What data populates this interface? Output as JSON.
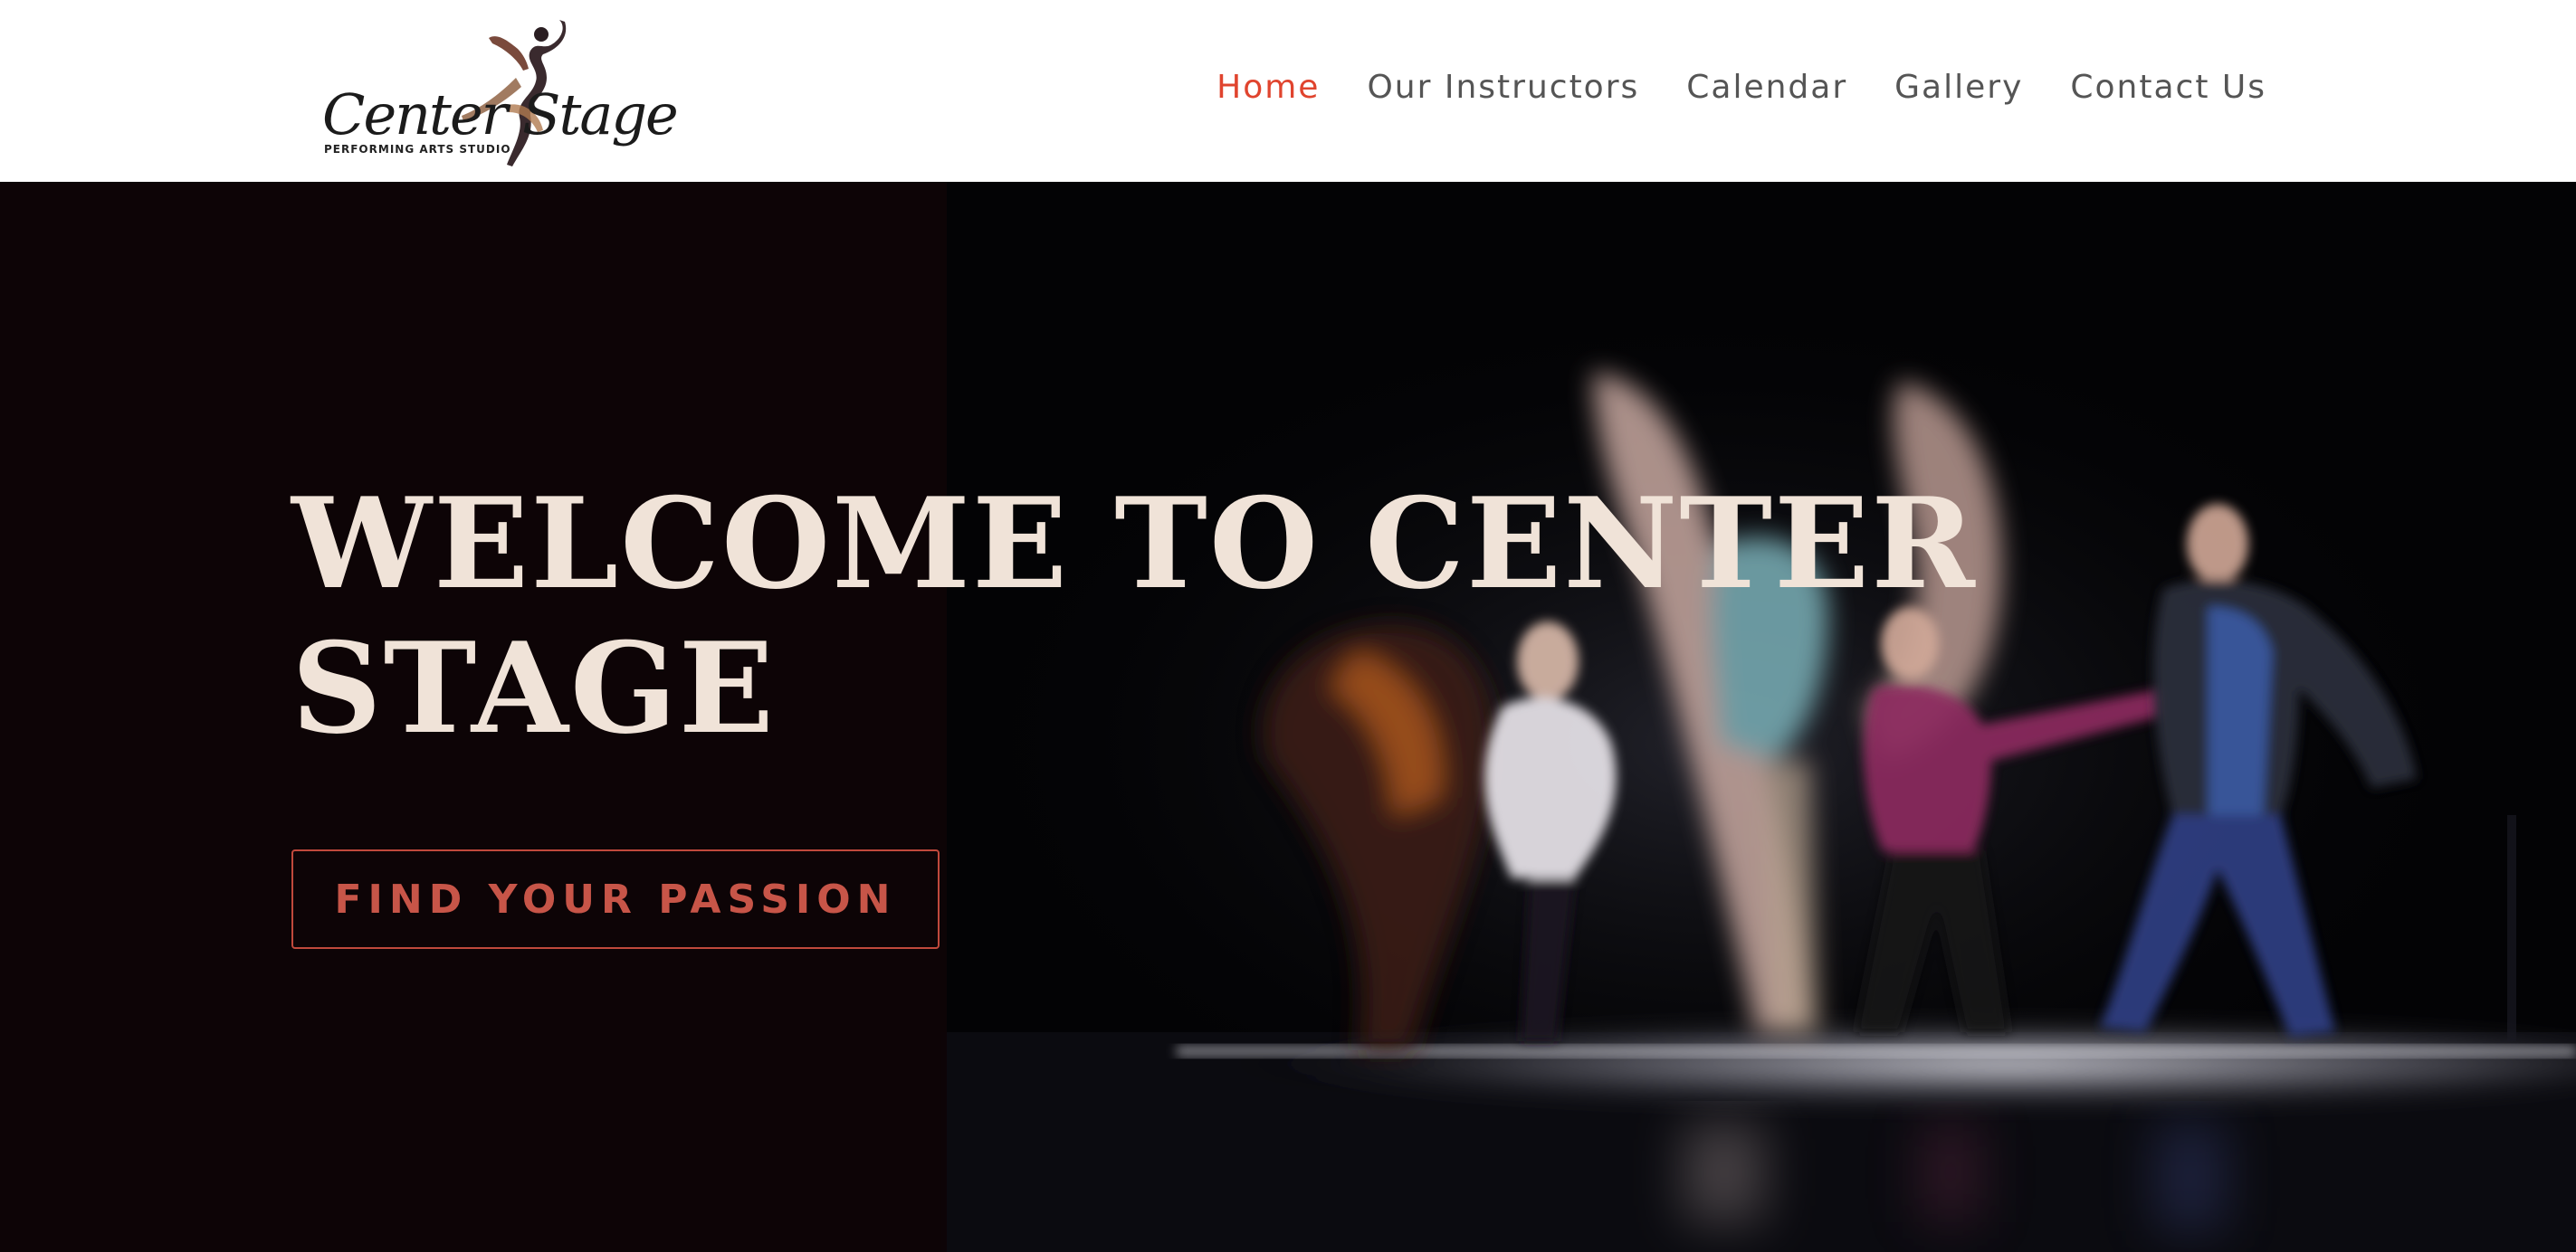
{
  "header": {
    "logo": {
      "name": "Center Stage",
      "tagline": "PERFORMING ARTS STUDIO"
    },
    "nav": [
      {
        "label": "Home",
        "active": true
      },
      {
        "label": "Our Instructors",
        "active": false
      },
      {
        "label": "Calendar",
        "active": false
      },
      {
        "label": "Gallery",
        "active": false
      },
      {
        "label": "Contact Us",
        "active": false
      }
    ]
  },
  "hero": {
    "title": "WELCOME TO CENTER STAGE",
    "cta_label": "FIND YOUR PASSION"
  },
  "colors": {
    "accent": "#e0442e",
    "nav_text": "#555555",
    "hero_title": "#f0e3d8",
    "cta": "#c75548",
    "hero_bg": "#060408"
  }
}
